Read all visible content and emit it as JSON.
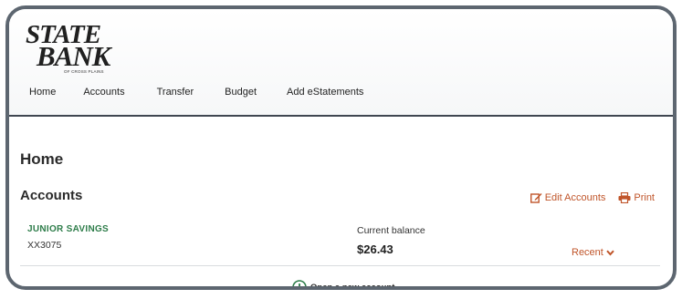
{
  "logo": {
    "line1": "STATE",
    "line2": "BANK",
    "tagline": "OF CROSS PLAINS"
  },
  "nav": {
    "items": [
      {
        "label": "Home"
      },
      {
        "label": "Accounts"
      },
      {
        "label": "Transfer"
      },
      {
        "label": "Budget"
      },
      {
        "label": "Add eStatements"
      }
    ]
  },
  "page": {
    "title": "Home"
  },
  "accounts": {
    "title": "Accounts",
    "edit_label": "Edit Accounts",
    "print_label": "Print",
    "items": [
      {
        "name": "JUNIOR SAVINGS",
        "number": "XX3075",
        "balance_label": "Current balance",
        "balance": "$26.43",
        "recent_label": "Recent"
      }
    ],
    "open_label": "Open a new account"
  },
  "colors": {
    "accent": "#c0552a",
    "account_name": "#2e7d4a",
    "frame": "#5d6670"
  }
}
